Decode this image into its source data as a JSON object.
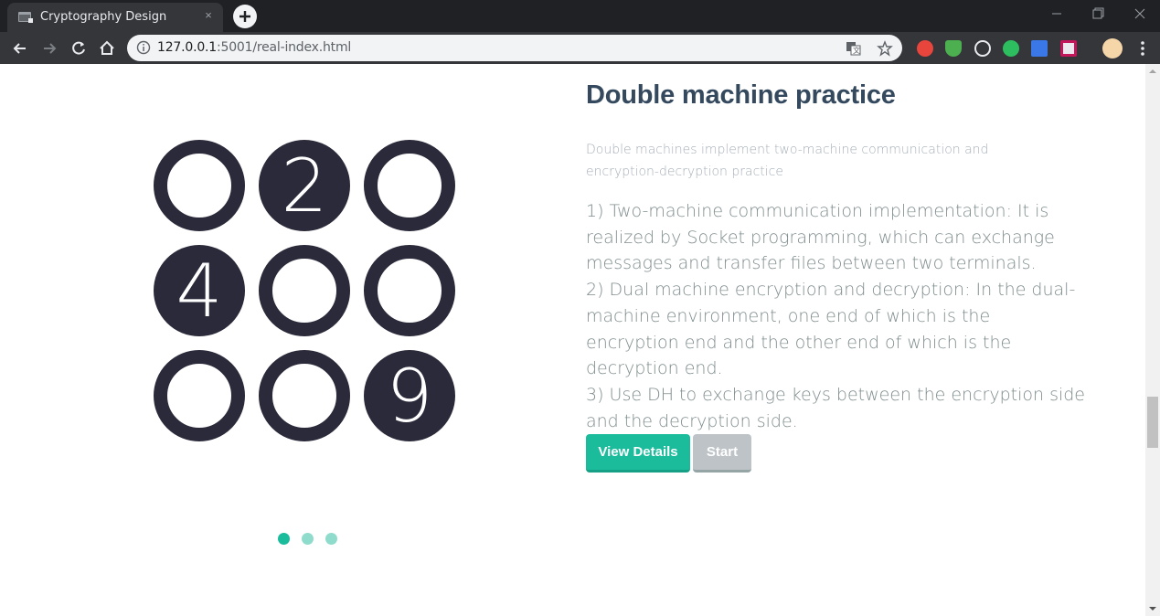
{
  "browser": {
    "tab_title": "Cryptography Design",
    "tab_close_glyph": "×",
    "url_host": "127.0.0.1",
    "url_rest": ":5001/real-index.html"
  },
  "hero": {
    "grid": [
      {
        "digit": "",
        "filled": false
      },
      {
        "digit": "2",
        "filled": true
      },
      {
        "digit": "",
        "filled": false
      },
      {
        "digit": "4",
        "filled": true
      },
      {
        "digit": "",
        "filled": false
      },
      {
        "digit": "",
        "filled": false
      },
      {
        "digit": "",
        "filled": false
      },
      {
        "digit": "",
        "filled": false
      },
      {
        "digit": "9",
        "filled": true
      }
    ],
    "circle_color": "#2a2a3a"
  },
  "content": {
    "heading": "Double machine practice",
    "subtitle": "Double machines implement two-machine communication and encryption-decryption practice",
    "points": [
      "1) Two-machine communication implementation: It is realized by Socket programming, which can exchange messages and transfer files between two terminals.",
      "2) Dual machine encryption and decryption: In the dual-machine environment, one end of which is the encryption end and the other end of which is the decryption end.",
      "3) Use DH to exchange keys between the encryption side and the decryption side."
    ],
    "view_details_label": "View Details",
    "start_label": "Start"
  },
  "carousel": {
    "active_index": 0,
    "count": 3,
    "active_color": "#1abc9c",
    "inactive_color": "#8fdccd"
  },
  "colors": {
    "accent": "#1abc9c",
    "heading": "#34495e",
    "body_text": "#7f8c8d"
  }
}
